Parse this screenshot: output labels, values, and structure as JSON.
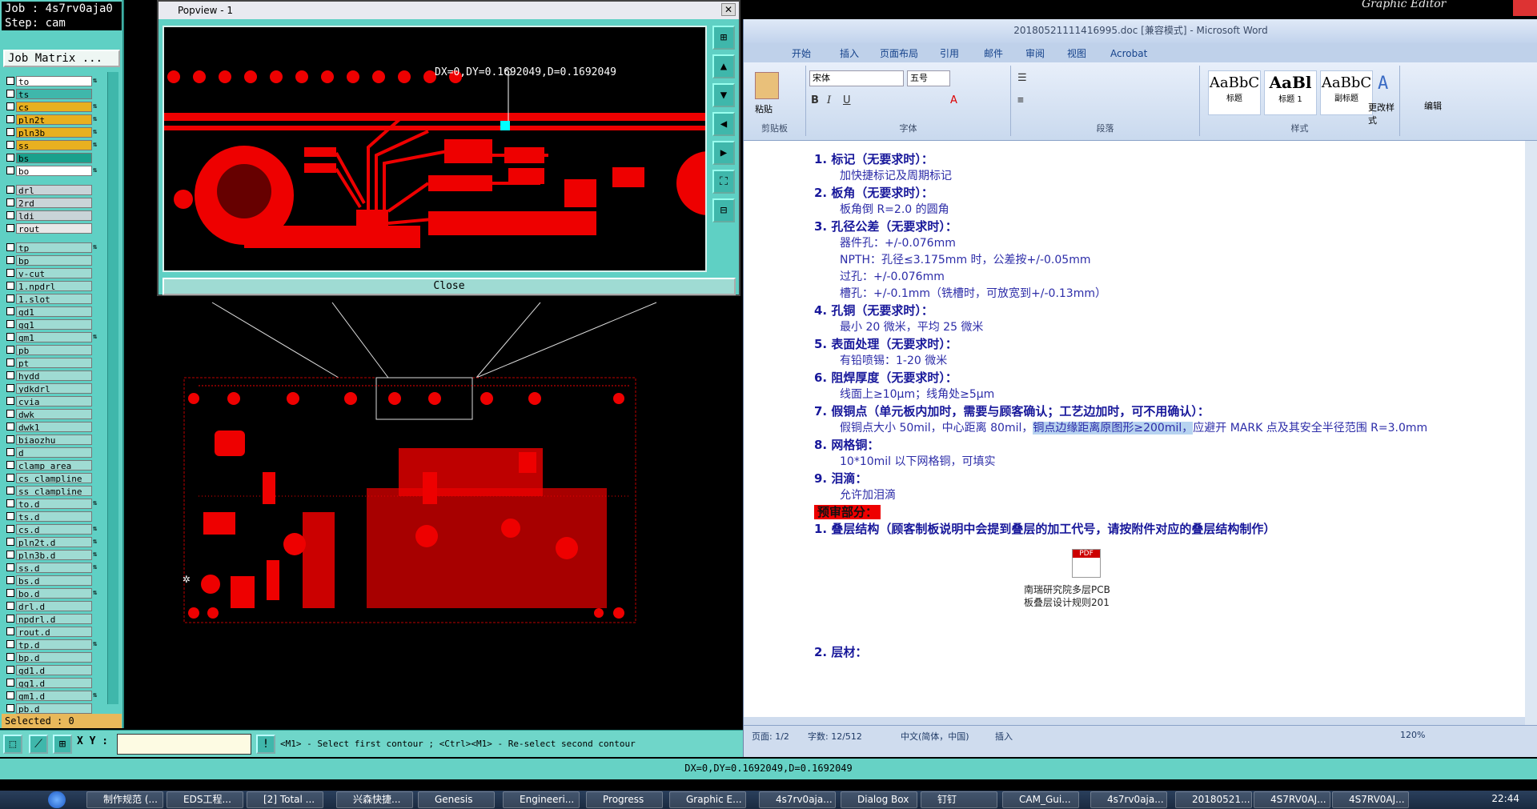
{
  "left_panel": {
    "job": "Job : 4s7rv0aja0",
    "step": "Step: cam",
    "job_matrix": "Job Matrix ...",
    "layers": [
      {
        "name": "to",
        "color": "#ffffff",
        "ind": "⇅"
      },
      {
        "name": "ts",
        "color": "#3fb7ab",
        "ind": ""
      },
      {
        "name": "cs",
        "color": "#e8b020",
        "ind": "⇅"
      },
      {
        "name": "pln2t",
        "color": "#e8b020",
        "ind": "⇅"
      },
      {
        "name": "pln3b",
        "color": "#e8b020",
        "ind": "⇅"
      },
      {
        "name": "ss",
        "color": "#e8b020",
        "ind": "⇅"
      },
      {
        "name": "bs",
        "color": "#1aa08c",
        "ind": ""
      },
      {
        "name": "bo",
        "color": "#ffffff",
        "ind": "⇅"
      },
      {
        "name": "drl",
        "color": "#c9d4d8",
        "ind": ""
      },
      {
        "name": "2rd",
        "color": "#c9d4d8",
        "ind": ""
      },
      {
        "name": "ldi",
        "color": "#c9d4d8",
        "ind": ""
      },
      {
        "name": "rout",
        "color": "#e8e8e8",
        "ind": ""
      },
      {
        "name": "tp",
        "color": "#9fdbd3",
        "ind": "⇅"
      },
      {
        "name": "bp",
        "color": "#9fdbd3",
        "ind": ""
      },
      {
        "name": "v-cut",
        "color": "#9fdbd3",
        "ind": ""
      },
      {
        "name": "1.npdrl",
        "color": "#9fdbd3",
        "ind": ""
      },
      {
        "name": "1.slot",
        "color": "#9fdbd3",
        "ind": ""
      },
      {
        "name": "gd1",
        "color": "#9fdbd3",
        "ind": ""
      },
      {
        "name": "gg1",
        "color": "#9fdbd3",
        "ind": ""
      },
      {
        "name": "gm1",
        "color": "#9fdbd3",
        "ind": "⇅"
      },
      {
        "name": "pb",
        "color": "#9fdbd3",
        "ind": ""
      },
      {
        "name": "pt",
        "color": "#9fdbd3",
        "ind": ""
      },
      {
        "name": "hydd",
        "color": "#9fdbd3",
        "ind": ""
      },
      {
        "name": "ydkdrl",
        "color": "#9fdbd3",
        "ind": ""
      },
      {
        "name": "cvia",
        "color": "#9fdbd3",
        "ind": ""
      },
      {
        "name": "dwk",
        "color": "#9fdbd3",
        "ind": ""
      },
      {
        "name": "dwk1",
        "color": "#9fdbd3",
        "ind": ""
      },
      {
        "name": "biaozhu",
        "color": "#9fdbd3",
        "ind": ""
      },
      {
        "name": "d",
        "color": "#9fdbd3",
        "ind": ""
      },
      {
        "name": "clamp_area",
        "color": "#9fdbd3",
        "ind": ""
      },
      {
        "name": "cs_clampline",
        "color": "#9fdbd3",
        "ind": ""
      },
      {
        "name": "ss_clampline",
        "color": "#9fdbd3",
        "ind": ""
      },
      {
        "name": "to.d",
        "color": "#9fdbd3",
        "ind": "⇅"
      },
      {
        "name": "ts.d",
        "color": "#9fdbd3",
        "ind": ""
      },
      {
        "name": "cs.d",
        "color": "#9fdbd3",
        "ind": "⇅"
      },
      {
        "name": "pln2t.d",
        "color": "#9fdbd3",
        "ind": "⇅"
      },
      {
        "name": "pln3b.d",
        "color": "#9fdbd3",
        "ind": "⇅"
      },
      {
        "name": "ss.d",
        "color": "#9fdbd3",
        "ind": "⇅"
      },
      {
        "name": "bs.d",
        "color": "#9fdbd3",
        "ind": ""
      },
      {
        "name": "bo.d",
        "color": "#9fdbd3",
        "ind": "⇅"
      },
      {
        "name": "drl.d",
        "color": "#9fdbd3",
        "ind": ""
      },
      {
        "name": "npdrl.d",
        "color": "#9fdbd3",
        "ind": ""
      },
      {
        "name": "rout.d",
        "color": "#9fdbd3",
        "ind": ""
      },
      {
        "name": "tp.d",
        "color": "#9fdbd3",
        "ind": "⇅"
      },
      {
        "name": "bp.d",
        "color": "#9fdbd3",
        "ind": ""
      },
      {
        "name": "gd1.d",
        "color": "#9fdbd3",
        "ind": ""
      },
      {
        "name": "gg1.d",
        "color": "#9fdbd3",
        "ind": ""
      },
      {
        "name": "gm1.d",
        "color": "#9fdbd3",
        "ind": "⇅"
      },
      {
        "name": "pb.d",
        "color": "#9fdbd3",
        "ind": ""
      }
    ],
    "selected": "Selected : 0"
  },
  "popview": {
    "title": "Popview - 1",
    "measure": "DX=0,DY=0.1692049,D=0.1692049",
    "close_label": "Close"
  },
  "cmd": {
    "xy_label": "X Y :",
    "message": "<M1> - Select first contour ; <Ctrl><M1> - Re-select second contour",
    "status": "DX=0,DY=0.1692049,D=0.1692049"
  },
  "graphic_editor_title": "Graphic Editor",
  "word": {
    "title": "20180521111416995.doc [兼容模式] - Microsoft Word",
    "tabs": [
      "开始",
      "插入",
      "页面布局",
      "引用",
      "邮件",
      "审阅",
      "视图",
      "Acrobat"
    ],
    "font_name": "宋体",
    "font_size": "五号",
    "groups": {
      "clipboard": "剪贴板",
      "font": "字体",
      "paragraph": "段落",
      "styles": "样式",
      "paste": "粘贴"
    },
    "styles": [
      {
        "preview": "AaBbC",
        "label": "标题"
      },
      {
        "preview": "AaBl",
        "label": "标题 1"
      },
      {
        "preview": "AaBbC",
        "label": "副标题"
      }
    ],
    "change_styles": "更改样式",
    "edit": "编辑",
    "doc_lines": [
      {
        "t": "1. 标记（无要求时）：",
        "kind": "head"
      },
      {
        "t": "加快捷标记及周期标记",
        "kind": "sub"
      },
      {
        "t": "2. 板角（无要求时）：",
        "kind": "head"
      },
      {
        "t": "板角倒 R=2.0 的圆角",
        "kind": "sub"
      },
      {
        "t": "3. 孔径公差（无要求时）：",
        "kind": "head"
      },
      {
        "t": "器件孔：+/-0.076mm",
        "kind": "sub"
      },
      {
        "t": "NPTH：孔径≤3.175mm 时，公差按+/-0.05mm",
        "kind": "sub"
      },
      {
        "t": "过孔：+/-0.076mm",
        "kind": "sub"
      },
      {
        "t": "槽孔：+/-0.1mm（铣槽时，可放宽到+/-0.13mm）",
        "kind": "sub"
      },
      {
        "t": "4. 孔铜（无要求时）：",
        "kind": "head"
      },
      {
        "t": "最小 20 微米，平均 25 微米",
        "kind": "sub"
      },
      {
        "t": "5. 表面处理（无要求时）：",
        "kind": "head"
      },
      {
        "t": "有铅喷锡：1-20 微米",
        "kind": "sub"
      },
      {
        "t": "6. 阻焊厚度（无要求时）：",
        "kind": "head"
      },
      {
        "t": "线面上≥10μm；线角处≥5μm",
        "kind": "sub"
      },
      {
        "t": "7. 假铜点（单元板内加时，需要与顾客确认；工艺边加时，可不用确认）：",
        "kind": "head"
      },
      {
        "t": "假铜点大小 50mil，中心距离 80mil，",
        "kind": "sub",
        "hl": "铜点边缘距离原图形≥200mil，",
        "tail": "应避开 MARK 点及其安全半径范围 R=3.0mm"
      },
      {
        "t": "8. 网格铜：",
        "kind": "head"
      },
      {
        "t": "10*10mil 以下网格铜，可填实",
        "kind": "sub"
      },
      {
        "t": "9. 泪滴：",
        "kind": "head"
      },
      {
        "t": "允许加泪滴",
        "kind": "sub"
      },
      {
        "t": "预审部分：",
        "kind": "red"
      },
      {
        "t": "1. 叠层结构（顾客制板说明中会提到叠层的加工代号，请按附件对应的叠层结构制作）",
        "kind": "head"
      }
    ],
    "attachment": [
      "南瑞研究院多层PCB",
      "板叠层设计规则201"
    ],
    "last_line": "2. 层材：",
    "status": {
      "page": "页面: 1/2",
      "words": "字数: 12/512",
      "lang": "中文(简体，中国)",
      "mode": "插入",
      "zoom": "120%"
    }
  },
  "taskbar": {
    "items": [
      "制作规范 (...",
      "EDS工程...",
      "[2] Total ...",
      "兴森快捷...",
      "Genesis",
      "Engineeri...",
      "Progress",
      "Graphic E...",
      "4s7rv0aja...",
      "Dialog Box",
      "钉钉",
      "CAM_Gui...",
      "4s7rv0aja...",
      "20180521...",
      "4S7RV0AJ...",
      "4S7RV0AJ..."
    ],
    "time": "22:44"
  }
}
